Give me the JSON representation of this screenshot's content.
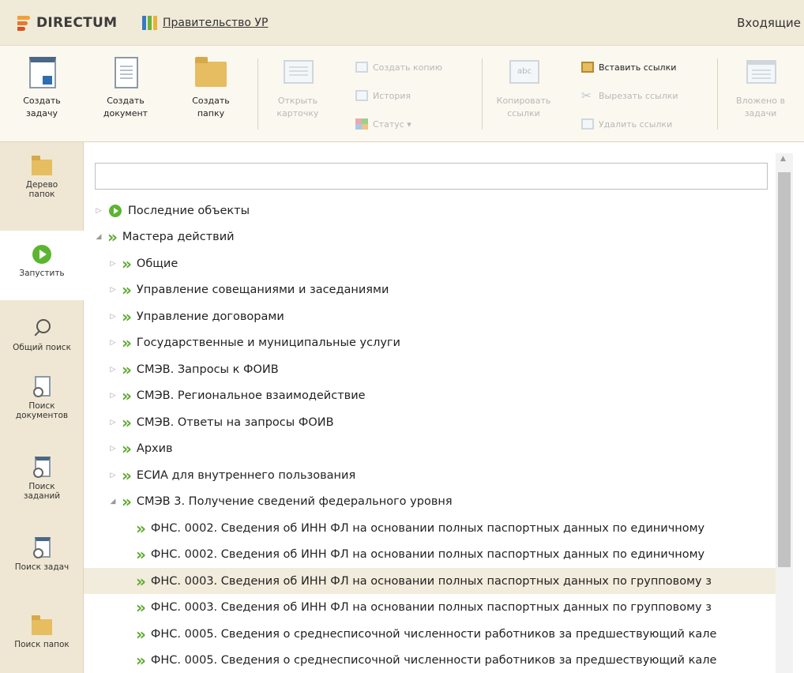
{
  "app": {
    "brand": "DIRECTUM",
    "organization": "Правительство УР",
    "current_folder": "Входящие"
  },
  "colors": {
    "titlebar_bg": "#f0ead8",
    "ribbon_bg": "#fbf8f0",
    "sidebar_bg": "#efe7d3",
    "accent_green": "#5cb531",
    "selection_bg": "#f2ecdc"
  },
  "ribbon": {
    "create_task": "Создать\nзадачу",
    "create_document": "Создать\nдокумент",
    "create_folder": "Создать\nпапку",
    "open_card": "Открыть\nкарточку",
    "create_copy": "Создать копию",
    "history": "История",
    "status": "Статус ▾",
    "copy_links": "Копировать\nссылки",
    "paste_links": "Вставить ссылки",
    "cut_links": "Вырезать ссылки",
    "delete_links": "Удалить ссылки",
    "attached_in_tasks": "Вложено в\nзадачи"
  },
  "sidebar": {
    "items": [
      {
        "label": "Дерево\nпапок",
        "icon": "folder-tree-icon"
      },
      {
        "label": "Запустить",
        "icon": "run-icon"
      },
      {
        "label": "Общий поиск",
        "icon": "search-icon"
      },
      {
        "label": "Поиск\nдокументов",
        "icon": "document-search-icon"
      },
      {
        "label": "Поиск\nзаданий",
        "icon": "assignment-search-icon"
      },
      {
        "label": "Поиск задач",
        "icon": "task-search-icon"
      },
      {
        "label": "Поиск папок",
        "icon": "folder-search-icon"
      }
    ]
  },
  "filter": {
    "value": ""
  },
  "tree": {
    "rows": [
      {
        "text": "Последние объекты",
        "level": 0,
        "state": "collapsed",
        "icon": "run-icon"
      },
      {
        "text": "Мастера действий",
        "level": 0,
        "state": "expanded",
        "icon": "chevron-icon"
      },
      {
        "text": "Общие",
        "level": 1,
        "state": "collapsed",
        "icon": "chevron-icon"
      },
      {
        "text": "Управление совещаниями и заседаниями",
        "level": 1,
        "state": "collapsed",
        "icon": "chevron-icon"
      },
      {
        "text": "Управление договорами",
        "level": 1,
        "state": "collapsed",
        "icon": "chevron-icon"
      },
      {
        "text": "Государственные и муниципальные услуги",
        "level": 1,
        "state": "collapsed",
        "icon": "chevron-icon"
      },
      {
        "text": "СМЭВ. Запросы к ФОИВ",
        "level": 1,
        "state": "collapsed",
        "icon": "chevron-icon"
      },
      {
        "text": "СМЭВ. Региональное взаимодействие",
        "level": 1,
        "state": "collapsed",
        "icon": "chevron-icon"
      },
      {
        "text": "СМЭВ. Ответы на запросы ФОИВ",
        "level": 1,
        "state": "collapsed",
        "icon": "chevron-icon"
      },
      {
        "text": "Архив",
        "level": 1,
        "state": "collapsed",
        "icon": "chevron-icon"
      },
      {
        "text": "ЕСИА для внутреннего пользования",
        "level": 1,
        "state": "collapsed",
        "icon": "chevron-icon"
      },
      {
        "text": "СМЭВ 3. Получение сведений федерального уровня",
        "level": 1,
        "state": "expanded",
        "icon": "chevron-icon"
      },
      {
        "text": "ФНС. 0002. Сведения об ИНН ФЛ на основании полных паспортных данных по единичному",
        "level": 2,
        "state": "leaf",
        "icon": "chevron-icon"
      },
      {
        "text": "ФНС. 0002. Сведения об ИНН ФЛ на основании полных паспортных данных по единичному",
        "level": 2,
        "state": "leaf",
        "icon": "chevron-icon"
      },
      {
        "text": "ФНС. 0003. Сведения об ИНН ФЛ на основании полных паспортных данных по групповому з",
        "level": 2,
        "state": "leaf",
        "icon": "chevron-icon",
        "selected": true
      },
      {
        "text": "ФНС. 0003. Сведения об ИНН ФЛ на основании полных паспортных данных по групповому з",
        "level": 2,
        "state": "leaf",
        "icon": "chevron-icon"
      },
      {
        "text": "ФНС. 0005. Сведения о среднесписочной численности работников за предшествующий кале",
        "level": 2,
        "state": "leaf",
        "icon": "chevron-icon"
      },
      {
        "text": "ФНС. 0005. Сведения о среднесписочной численности работников за предшествующий кале",
        "level": 2,
        "state": "leaf",
        "icon": "chevron-icon"
      }
    ]
  }
}
